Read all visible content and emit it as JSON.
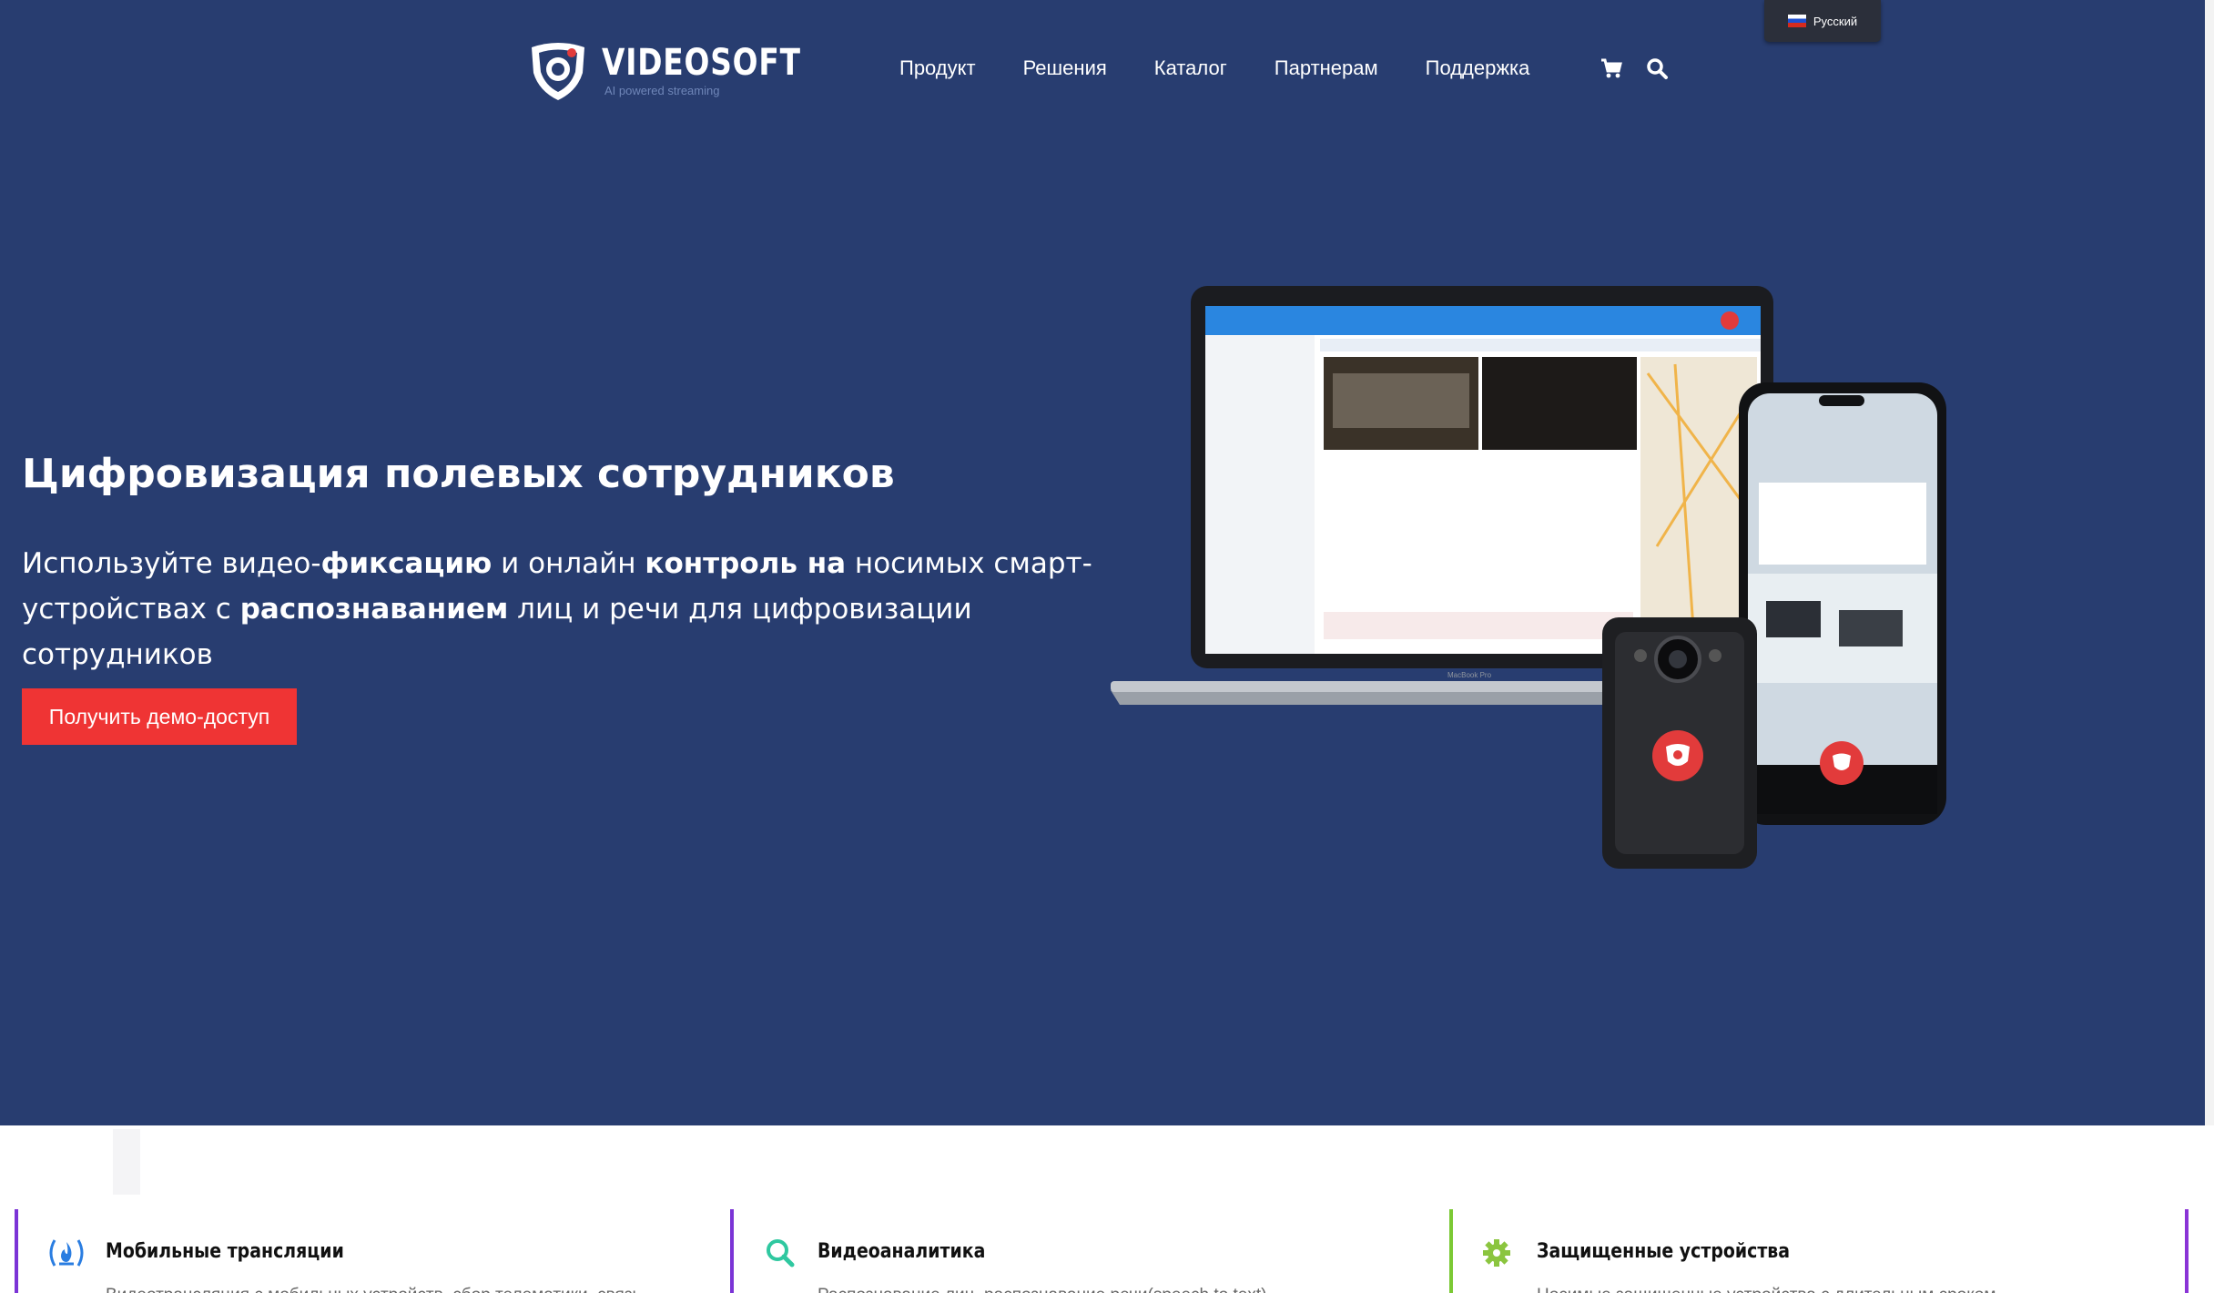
{
  "header": {
    "logo_text": "VIDEOSOFT",
    "logo_tagline": "AI powered streaming",
    "nav": [
      "Продукт",
      "Решения",
      "Каталог",
      "Партнерам",
      "Поддержка"
    ],
    "cart_icon": "cart-icon",
    "search_icon": "search-icon",
    "language": "Русский"
  },
  "hero": {
    "title": "Цифровизация полевых сотрудников",
    "text_parts": [
      "Используйте видео-",
      "фиксацию",
      " и онлайн ",
      "контроль на",
      "  носимых смарт-устройствах с ",
      "распознаванием",
      " лиц и речи для цифровизации сотрудников"
    ],
    "cta_label": "Получить демо-доступ",
    "laptop_label": "MacBook Pro"
  },
  "features": [
    {
      "icon": "broadcast-icon",
      "title": "Мобильные трансляции",
      "desc": "Видеотрансляция с мобильных устройств, сбор телематики, связь"
    },
    {
      "icon": "search-icon",
      "title": "Видеоаналитика",
      "desc": "Распознавание лиц, распознавание речи(speech to text),"
    },
    {
      "icon": "gear-icon",
      "title": "Защищенные устройства",
      "desc": "Носимые защищенные устройства с длительным сроком"
    }
  ],
  "colors": {
    "hero_bg": "#283d70",
    "cta": "#ef3434",
    "accent_purple": "#7b34d6",
    "accent_green": "#7bc934"
  }
}
